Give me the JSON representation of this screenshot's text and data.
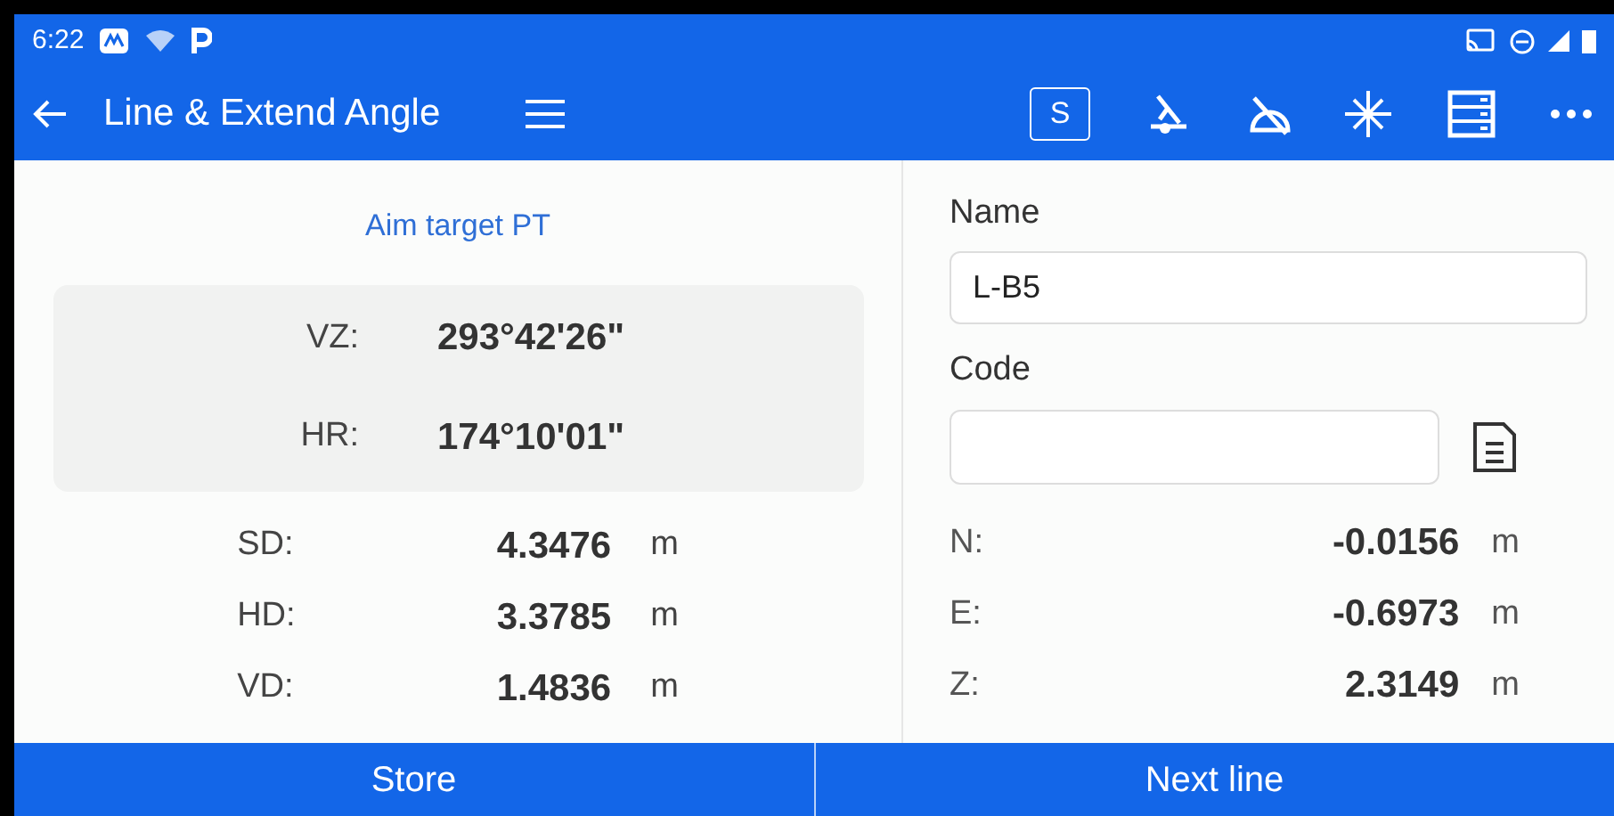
{
  "status_bar": {
    "time": "6:22"
  },
  "app_bar": {
    "title": "Line & Extend Angle",
    "s_button": "S"
  },
  "measure": {
    "hint": "Aim target PT",
    "angles": [
      {
        "label": "VZ:",
        "value": "293°42'26\""
      },
      {
        "label": "HR:",
        "value": "174°10'01\""
      }
    ],
    "distances": [
      {
        "label": "SD:",
        "value": "4.3476",
        "unit": "m"
      },
      {
        "label": "HD:",
        "value": "3.3785",
        "unit": "m"
      },
      {
        "label": "VD:",
        "value": "1.4836",
        "unit": "m"
      }
    ]
  },
  "point": {
    "name_label": "Name",
    "name_value": "L-B5",
    "code_label": "Code",
    "coords": [
      {
        "label": "N:",
        "value": "-0.0156",
        "unit": "m"
      },
      {
        "label": "E:",
        "value": "-0.6973",
        "unit": "m"
      },
      {
        "label": "Z:",
        "value": "2.3149",
        "unit": "m"
      }
    ]
  },
  "buttons": [
    "Store",
    "Next line"
  ]
}
